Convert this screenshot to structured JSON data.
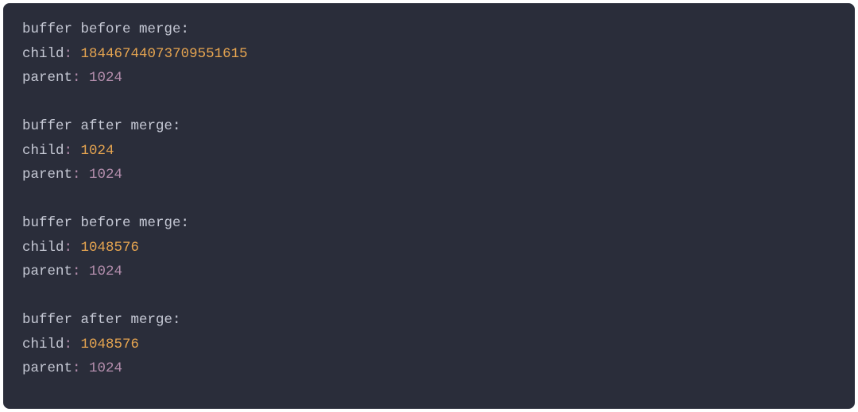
{
  "blocks": [
    {
      "header": "buffer before merge:",
      "child_label": "child",
      "child_value": "18446744073709551615",
      "parent_label": "parent",
      "parent_value": "1024"
    },
    {
      "header": "buffer after merge:",
      "child_label": "child",
      "child_value": "1024",
      "parent_label": "parent",
      "parent_value": "1024"
    },
    {
      "header": "buffer before merge:",
      "child_label": "child",
      "child_value": "1048576",
      "parent_label": "parent",
      "parent_value": "1024"
    },
    {
      "header": "buffer after merge:",
      "child_label": "child",
      "child_value": "1048576",
      "parent_label": "parent",
      "parent_value": "1024"
    }
  ],
  "sep_colon": ":",
  "sep_space": " "
}
